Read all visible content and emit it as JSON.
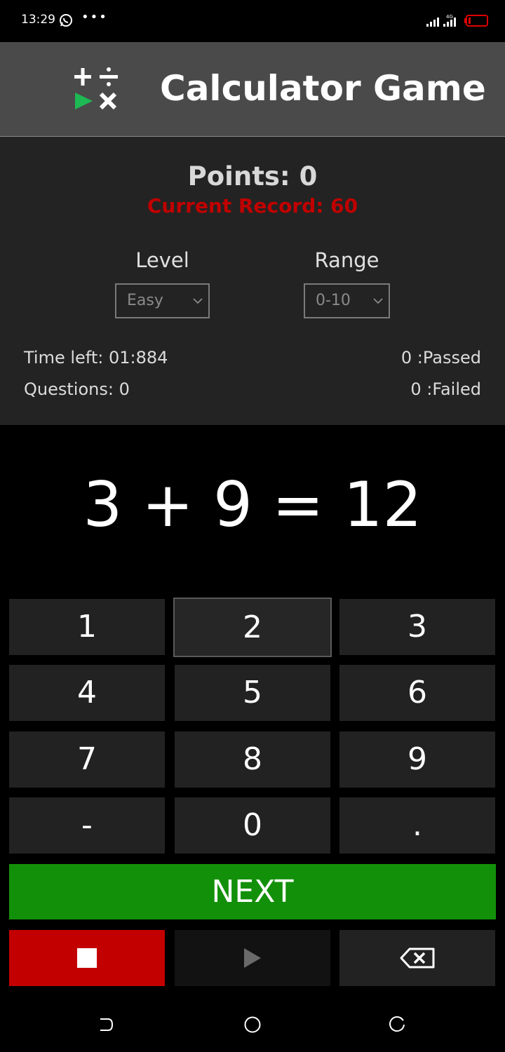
{
  "status_bar": {
    "time": "13:29",
    "network": "4G"
  },
  "app": {
    "title": "Calculator Game"
  },
  "scores": {
    "points": "Points: 0",
    "record": "Current Record: 60"
  },
  "selectors": {
    "level": {
      "label": "Level",
      "value": "Easy"
    },
    "range": {
      "label": "Range",
      "value": "0-10"
    }
  },
  "stats": {
    "time_left": "Time left: 01:884",
    "questions": "Questions: 0",
    "passed": "0 :Passed",
    "failed": "0 :Failed"
  },
  "equation": "3 + 9 = 12",
  "keypad": {
    "keys": [
      "1",
      "2",
      "3",
      "4",
      "5",
      "6",
      "7",
      "8",
      "9",
      "-",
      "0",
      "."
    ],
    "next_label": "NEXT"
  },
  "colors": {
    "header_bg": "#4a4a4a",
    "record_red": "#c00000",
    "next_green": "#13900a",
    "stop_red": "#c30000",
    "logo_green": "#1db954"
  },
  "icons": {
    "logo": "plus-divide-play-times-icon",
    "stop": "stop-icon",
    "play": "play-icon",
    "backspace": "backspace-icon",
    "nav_back": "back-icon",
    "nav_home": "home-icon",
    "nav_recents": "recents-icon"
  }
}
